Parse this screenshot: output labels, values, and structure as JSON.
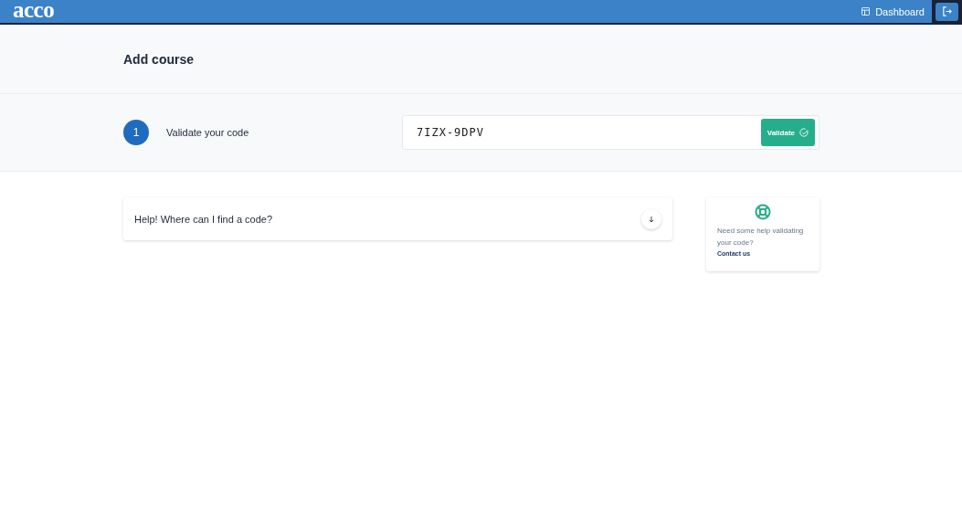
{
  "header": {
    "logo": "acco",
    "nav": [
      {
        "label": "Dashboard"
      }
    ]
  },
  "page": {
    "title": "Add course"
  },
  "step": {
    "number": "1",
    "label": "Validate your code",
    "code": {
      "value": "7IZX-9DPV"
    },
    "button": "Validate"
  },
  "faq": [
    {
      "question": "Help! Where can I find a code?",
      "expanded": false
    }
  ],
  "help": {
    "text": "Need some help validating your code?",
    "link": "Contact us"
  }
}
